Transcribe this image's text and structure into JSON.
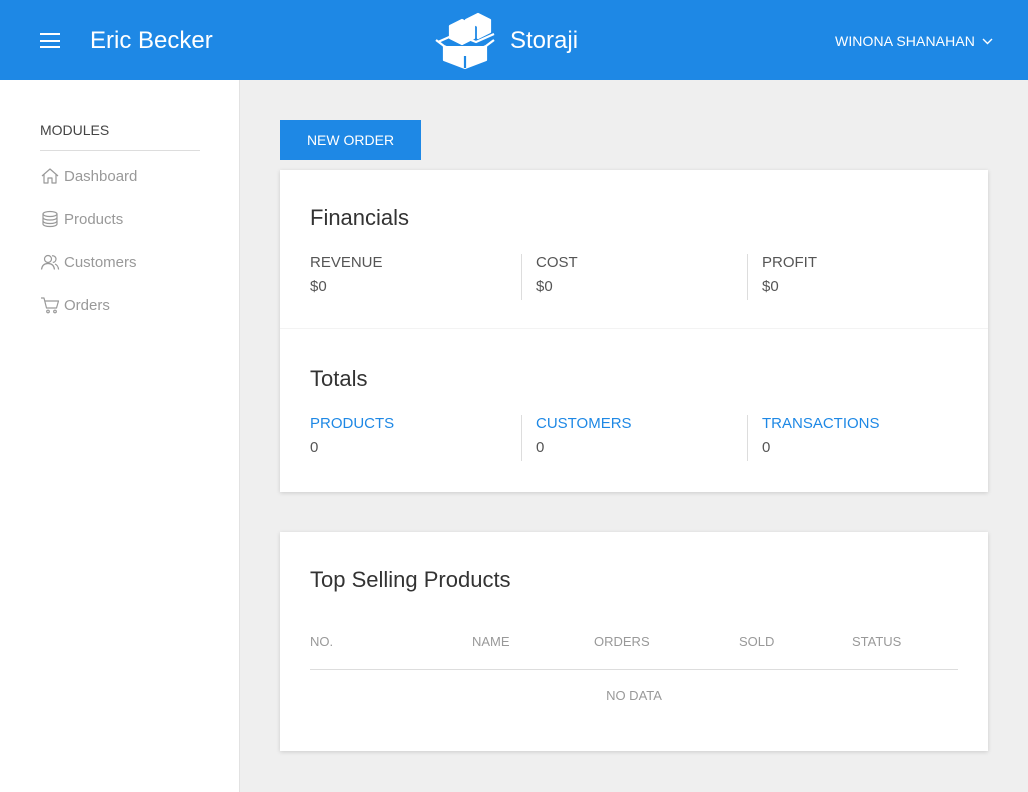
{
  "header": {
    "store_name": "Eric Becker",
    "brand_name": "Storaji",
    "user_name": "WINONA SHANAHAN",
    "icons": {
      "menu": "hamburger-icon",
      "logo": "boxes-logo",
      "user_dropdown": "chevron-down-icon"
    }
  },
  "sidebar": {
    "title": "MODULES",
    "items": [
      {
        "label": "Dashboard",
        "icon": "home-icon"
      },
      {
        "label": "Products",
        "icon": "database-icon"
      },
      {
        "label": "Customers",
        "icon": "users-icon"
      },
      {
        "label": "Orders",
        "icon": "cart-icon"
      }
    ]
  },
  "actions": {
    "new_order": "NEW ORDER"
  },
  "financials": {
    "title": "Financials",
    "stats": [
      {
        "label": "REVENUE",
        "value": "$0"
      },
      {
        "label": "COST",
        "value": "$0"
      },
      {
        "label": "PROFIT",
        "value": "$0"
      }
    ]
  },
  "totals": {
    "title": "Totals",
    "stats": [
      {
        "label": "PRODUCTS",
        "value": "0"
      },
      {
        "label": "CUSTOMERS",
        "value": "0"
      },
      {
        "label": "TRANSACTIONS",
        "value": "0"
      }
    ]
  },
  "top_selling": {
    "title": "Top Selling Products",
    "columns": [
      "NO.",
      "NAME",
      "ORDERS",
      "SOLD",
      "STATUS"
    ],
    "empty_text": "NO DATA"
  },
  "colors": {
    "primary": "#1e88e5",
    "background": "#efefef",
    "muted_text": "#999999"
  }
}
